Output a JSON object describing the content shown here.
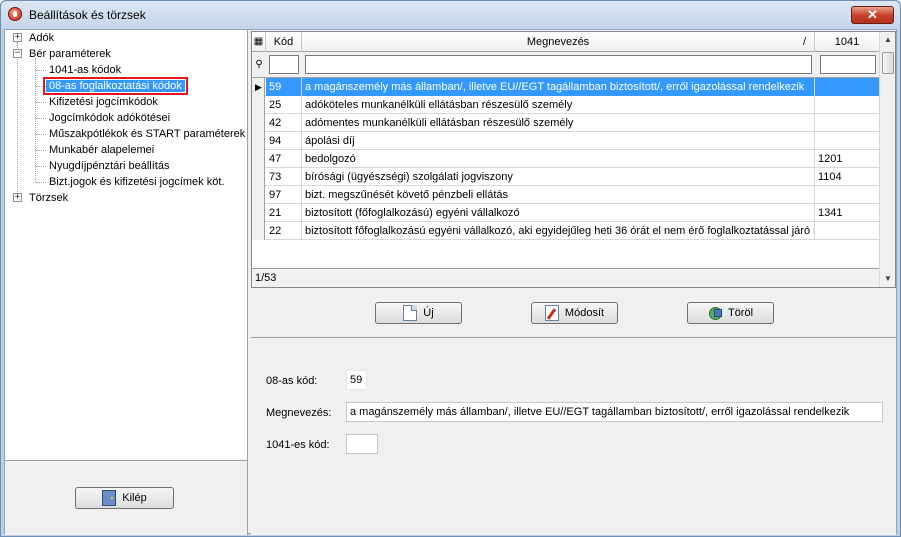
{
  "window": {
    "title": "Beállítások és törzsek",
    "close_label": "✕"
  },
  "tree": {
    "items": [
      {
        "label": "Adók",
        "expander": "+"
      },
      {
        "label": "Bér paraméterek",
        "expander": "−"
      },
      {
        "label": "1041-as kódok"
      },
      {
        "label": "08-as foglalkoztatási kódok"
      },
      {
        "label": "Kifizetési jogcímkódok"
      },
      {
        "label": "Jogcímkódok adókötései"
      },
      {
        "label": "Műszakpótlékok és START paraméterek"
      },
      {
        "label": "Munkabér alapelemei"
      },
      {
        "label": "Nyugdíjpénztári beállítás"
      },
      {
        "label": "Bizt.jogok és kifizetési jogcímek köt."
      },
      {
        "label": "Törzsek",
        "expander": "+"
      }
    ]
  },
  "exit_button": {
    "label": "Kilép"
  },
  "grid": {
    "columns": [
      "Kód",
      "Megnevezés",
      "1041"
    ],
    "sort_indicator": "/",
    "rows": [
      {
        "kod": "59",
        "megnevezes": "a magánszemély más államban/, illetve EU//EGT tagállamban biztosított/, erről igazolással rendelkezik",
        "c1041": ""
      },
      {
        "kod": "25",
        "megnevezes": "adóköteles munkanélküli ellátásban részesülő személy",
        "c1041": ""
      },
      {
        "kod": "42",
        "megnevezes": "adómentes munkanélküli ellátásban részesülő személy",
        "c1041": ""
      },
      {
        "kod": "94",
        "megnevezes": "ápolási díj",
        "c1041": ""
      },
      {
        "kod": "47",
        "megnevezes": "bedolgozó",
        "c1041": "1201"
      },
      {
        "kod": "73",
        "megnevezes": "bírósági (ügyészségi) szolgálati jogviszony",
        "c1041": "1104"
      },
      {
        "kod": "97",
        "megnevezes": "bizt. megszűnését követő pénzbeli ellátás",
        "c1041": ""
      },
      {
        "kod": "21",
        "megnevezes": "biztosított (főfoglalkozású) egyéni vállalkozó",
        "c1041": "1341"
      },
      {
        "kod": "22",
        "megnevezes": "biztosított főfoglalkozású egyéni vállalkozó, aki egyidejűleg heti 36 órát el nem érő foglalkoztatással járó mu...",
        "c1041": ""
      }
    ],
    "record_counter": "1/53"
  },
  "actions": {
    "new_label": "Új",
    "edit_label": "Módosít",
    "delete_label": "Töröl"
  },
  "detail": {
    "code_label": "08-as kód:",
    "code_value": "59",
    "name_label": "Megnevezés:",
    "name_value": "a magánszemély más államban/, illetve EU//EGT tagállamban biztosított/, erről igazolással rendelkezik",
    "code1041_label": "1041-es kód:",
    "code1041_value": ""
  }
}
